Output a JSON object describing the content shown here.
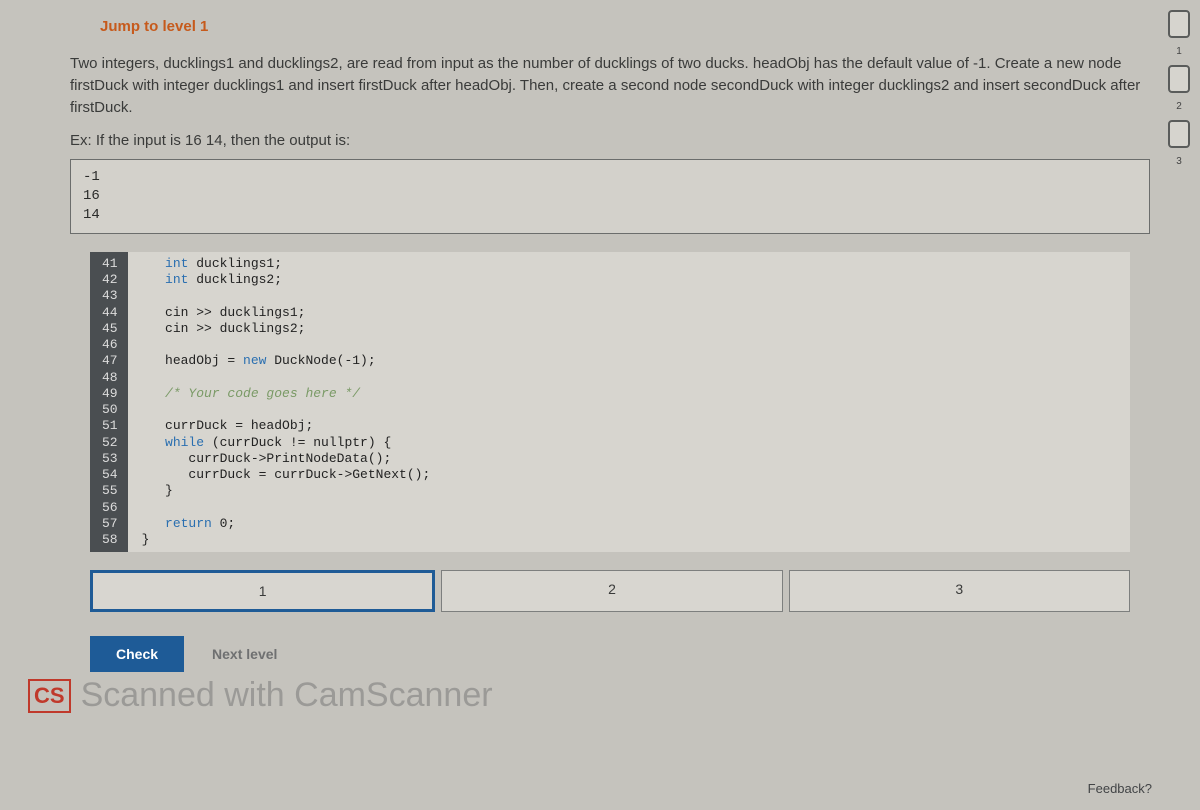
{
  "jump_link": "Jump to level 1",
  "instructions": "Two integers, ducklings1 and ducklings2, are read from input as the number of ducklings of two ducks. headObj has the default value of -1. Create a new node firstDuck with integer ducklings1 and insert firstDuck after headObj. Then, create a second node secondDuck with integer ducklings2 and insert secondDuck after firstDuck.",
  "example_label": "Ex: If the input is 16  14, then the output is:",
  "example_output": "-1\n16\n14",
  "line_numbers": "41\n42\n43\n44\n45\n46\n47\n48\n49\n50\n51\n52\n53\n54\n55\n56\n57\n58",
  "code": {
    "l41a": "int",
    "l41b": " ducklings1;",
    "l42a": "int",
    "l42b": " ducklings2;",
    "l44": "cin >> ducklings1;",
    "l45": "cin >> ducklings2;",
    "l47a": "headObj = ",
    "l47b": "new",
    "l47c": " DuckNode(-1);",
    "l49": "/* Your code goes here */",
    "l51": "currDuck = headObj;",
    "l52a": "while",
    "l52b": " (currDuck != nullptr) {",
    "l53": "   currDuck->PrintNodeData();",
    "l54": "   currDuck = currDuck->GetNext();",
    "l55": "}",
    "l57a": "return",
    "l57b": " 0;",
    "l58": "}"
  },
  "pagination": {
    "p1": "1",
    "p2": "2",
    "p3": "3"
  },
  "check_label": "Check",
  "next_level_label": "Next level",
  "watermark_badge": "CS",
  "watermark_text": "Scanned with CamScanner",
  "feedback_label": "Feedback?",
  "rail": {
    "n1": "1",
    "n2": "2",
    "n3": "3"
  }
}
